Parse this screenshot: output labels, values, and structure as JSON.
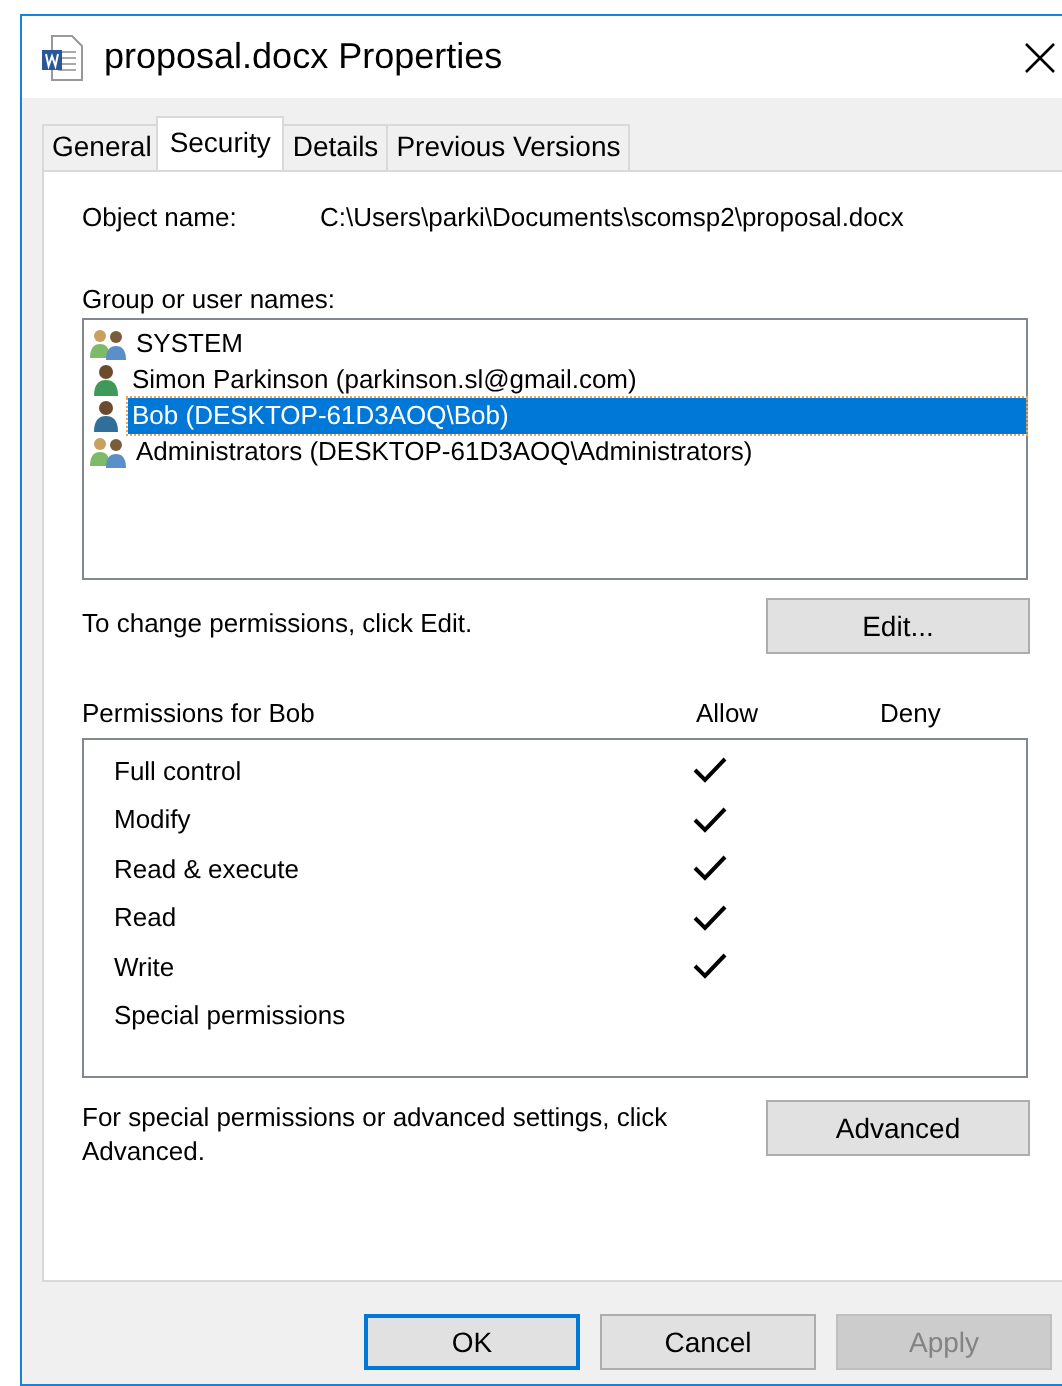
{
  "window": {
    "title": "proposal.docx Properties"
  },
  "tabs": [
    {
      "label": "General",
      "selected": false
    },
    {
      "label": "Security",
      "selected": true
    },
    {
      "label": "Details",
      "selected": false
    },
    {
      "label": "Previous Versions",
      "selected": false
    }
  ],
  "object_name": {
    "label": "Object name:",
    "value": "C:\\Users\\parki\\Documents\\scomsp2\\proposal.docx"
  },
  "group_list": {
    "label": "Group or user names:",
    "items": [
      {
        "kind": "group",
        "name": "SYSTEM",
        "selected": false
      },
      {
        "kind": "user",
        "name": "Simon Parkinson (parkinson.sl@gmail.com)",
        "selected": false
      },
      {
        "kind": "user",
        "name": "Bob (DESKTOP-61D3AOQ\\Bob)",
        "selected": true
      },
      {
        "kind": "group",
        "name": "Administrators (DESKTOP-61D3AOQ\\Administrators)",
        "selected": false
      }
    ]
  },
  "edit_hint": "To change permissions, click Edit.",
  "edit_button": {
    "label": "Edit..."
  },
  "permissions": {
    "label": "Permissions for Bob",
    "columns": [
      "Allow",
      "Deny"
    ],
    "rows": [
      {
        "name": "Full control",
        "allow": true,
        "deny": false
      },
      {
        "name": "Modify",
        "allow": true,
        "deny": false
      },
      {
        "name": "Read & execute",
        "allow": true,
        "deny": false
      },
      {
        "name": "Read",
        "allow": true,
        "deny": false
      },
      {
        "name": "Write",
        "allow": true,
        "deny": false
      },
      {
        "name": "Special permissions",
        "allow": false,
        "deny": false
      }
    ]
  },
  "advanced_hint": "For special permissions or advanced settings, click Advanced.",
  "advanced_button": {
    "label": "Advanced"
  },
  "buttons": [
    {
      "label": "OK",
      "kind": "default",
      "disabled": false
    },
    {
      "label": "Cancel",
      "kind": "normal",
      "disabled": false
    },
    {
      "label": "Apply",
      "kind": "normal",
      "disabled": true
    }
  ]
}
